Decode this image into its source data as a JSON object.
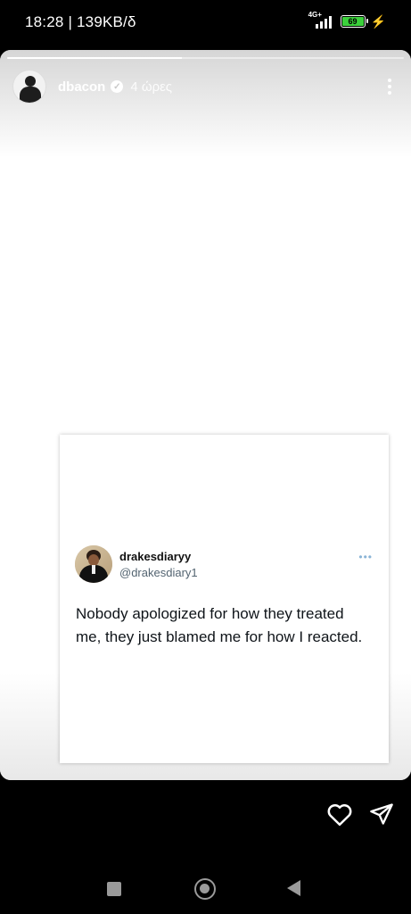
{
  "status_bar": {
    "time_speed": "18:28 | 139KB/δ",
    "network": "4G+",
    "battery_level": "69",
    "battery_color": "#3bd13b"
  },
  "story": {
    "progress": 0.44,
    "username": "dbacon",
    "verified_icon": "verified-badge-icon",
    "time_ago": "4 ώρες",
    "more_icon": "more-vertical-icon"
  },
  "tweet": {
    "display_name": "drakesdiaryy",
    "handle": "@drakesdiary1",
    "text": "Nobody apologized for how they treated me, they just blamed me for how I reacted.",
    "more_icon": "more-horizontal-icon"
  },
  "actions": {
    "like_icon": "heart-icon",
    "share_icon": "send-icon"
  },
  "nav": {
    "recents_icon": "square-icon",
    "home_icon": "circle-icon",
    "back_icon": "triangle-back-icon"
  }
}
